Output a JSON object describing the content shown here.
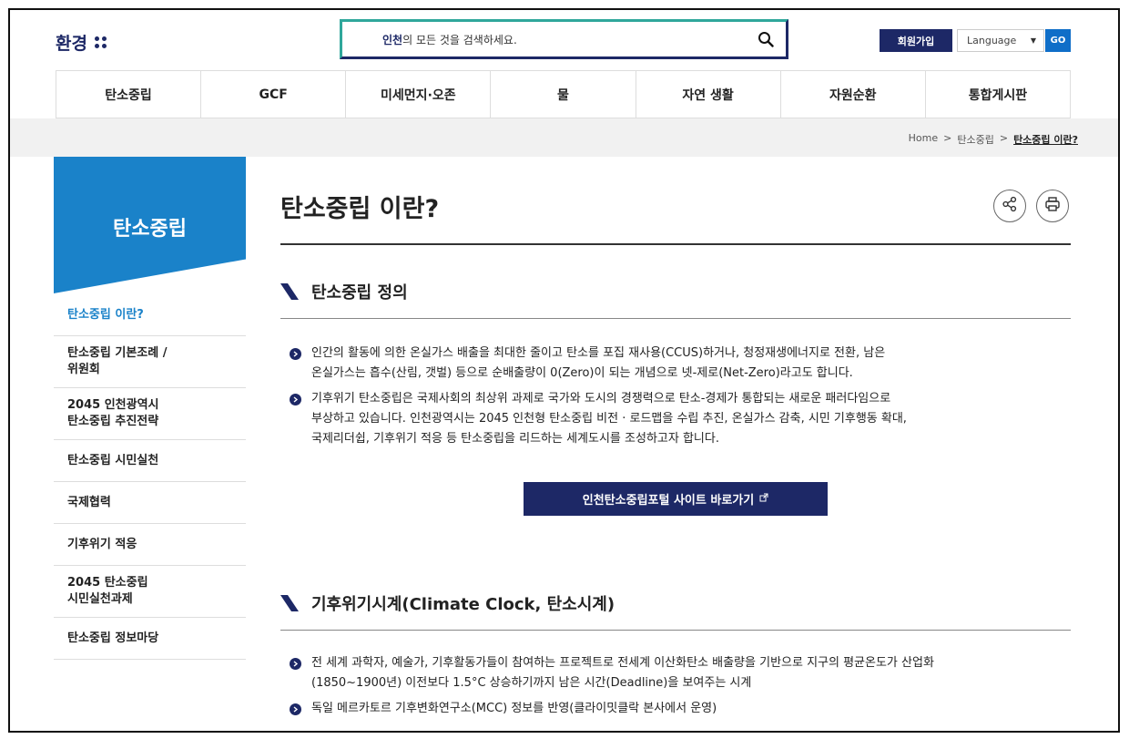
{
  "header": {
    "logo_text": "환경",
    "search_keyword": "인천",
    "search_placeholder_rest": "의 모든 것을 검색하세요.",
    "join_label": "회원가입",
    "language_label": "Language",
    "go_label": "GO"
  },
  "nav": {
    "items": [
      {
        "label": "탄소중립"
      },
      {
        "label": "GCF"
      },
      {
        "label": "미세먼지·오존"
      },
      {
        "label": "물"
      },
      {
        "label": "자연 생활"
      },
      {
        "label": "자원순환"
      },
      {
        "label": "통합게시판"
      }
    ]
  },
  "breadcrumb": {
    "home": "Home",
    "sep": ">",
    "level1": "탄소중립",
    "current": "탄소중립 이란?"
  },
  "sidebar": {
    "title": "탄소중립",
    "items": [
      {
        "line1": "탄소중립 이란?",
        "line2": ""
      },
      {
        "line1": "탄소중립 기본조례 /",
        "line2": "위원회"
      },
      {
        "line1": "2045 인천광역시",
        "line2": "탄소중립 추진전략"
      },
      {
        "line1": "탄소중립 시민실천",
        "line2": ""
      },
      {
        "line1": "국제협력",
        "line2": ""
      },
      {
        "line1": "기후위기 적응",
        "line2": ""
      },
      {
        "line1": "2045 탄소중립",
        "line2": "시민실천과제"
      },
      {
        "line1": "탄소중립 정보마당",
        "line2": ""
      }
    ]
  },
  "main": {
    "title": "탄소중립 이란?",
    "section1": {
      "title": "탄소중립 정의",
      "bullets": [
        {
          "line1": "인간의 활동에 의한 온실가스 배출을 최대한 줄이고 탄소를 포집 재사용(CCUS)하거나, 청정재생에너지로 전환, 남은",
          "line2": "온실가스는 흡수(산림, 갯벌) 등으로 순배출량이 0(Zero)이 되는 개념으로 넷-제로(Net-Zero)라고도 합니다.",
          "line3": ""
        },
        {
          "line1": "기후위기 탄소중립은 국제사회의 최상위 과제로 국가와 도시의 경쟁력으로 탄소-경제가 통합되는 새로운 패러다임으로",
          "line2": "부상하고 있습니다. 인천광역시는 2045 인천형 탄소중립 비전 · 로드맵을 수립 추진, 온실가스 감축, 시민 기후행동 확대,",
          "line3": "국제리더쉽, 기후위기 적응 등 탄소중립을 리드하는 세계도시를 조성하고자 합니다."
        }
      ],
      "button_label": "인천탄소중립포털 사이트 바로가기"
    },
    "section2": {
      "title": "기후위기시계(Climate Clock, 탄소시계)",
      "bullets": [
        {
          "line1": "전 세계 과학자, 예술가, 기후활동가들이 참여하는 프로젝트로 전세계 이산화탄소 배출량을 기반으로 지구의 평균온도가 산업화",
          "line2": "(1850~1900년) 이전보다 1.5°C 상승하기까지 남은 시간(Deadline)을 보여주는 시계"
        },
        {
          "line1": "독일 메르카토르 기후변화연구소(MCC) 정보를 반영(클라이밋클락 본사에서 운영)",
          "line2": ""
        }
      ]
    }
  },
  "colors": {
    "navy": "#1d2866",
    "blue": "#1a82c9",
    "teal": "#2fa79b",
    "go_blue": "#0f6ec8"
  }
}
